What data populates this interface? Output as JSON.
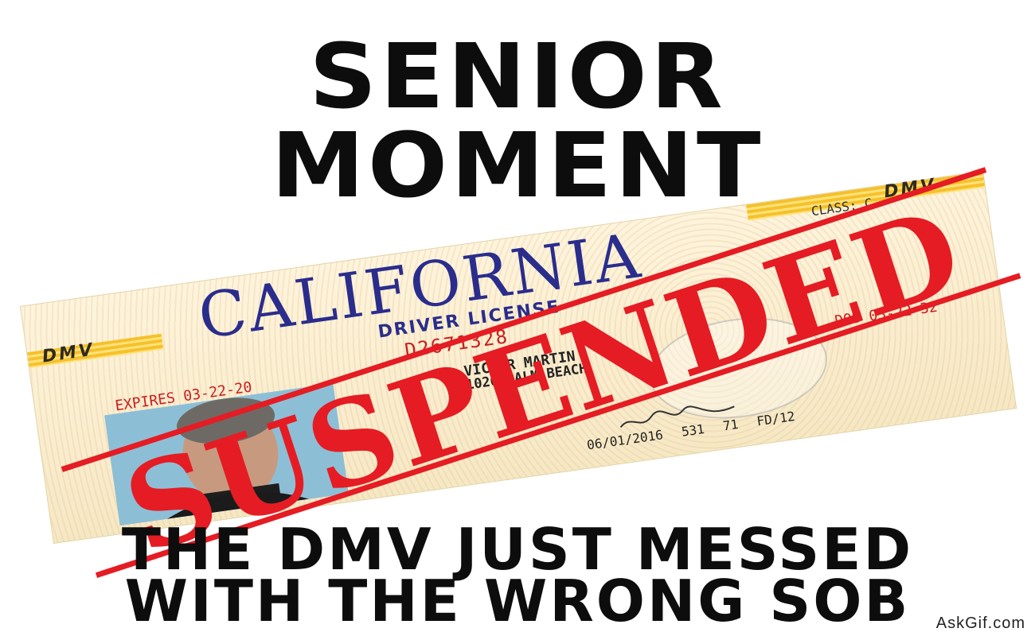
{
  "title": {
    "line1": "SENIOR",
    "line2": "MOMENT"
  },
  "license_card": {
    "state": "CALIFORNIA",
    "agency_mark": "DMV",
    "license_type": "DRIVER LICENSE",
    "license_number": "D2671328",
    "class": "CLASS: C",
    "expires": "EXPIRES 03-22-20",
    "name": "VICTOR MARTIN",
    "address_line1": "1020 PALM BEACH",
    "dob": "DOB 03-22-32",
    "footer": "06/01/2016 531 71 FD/12",
    "seal_text": "CALIFORNIA"
  },
  "stamp": {
    "text": "SUSPENDED"
  },
  "bottom_caption": {
    "line1": "THE DMV JUST MESSED",
    "line2": "WITH THE WRONG SOB"
  },
  "watermark": "AskGif.com",
  "colors": {
    "stamp_red": "#e51c23",
    "state_blue": "#2a2d8c",
    "stripe_gold": "#f5c12b"
  }
}
